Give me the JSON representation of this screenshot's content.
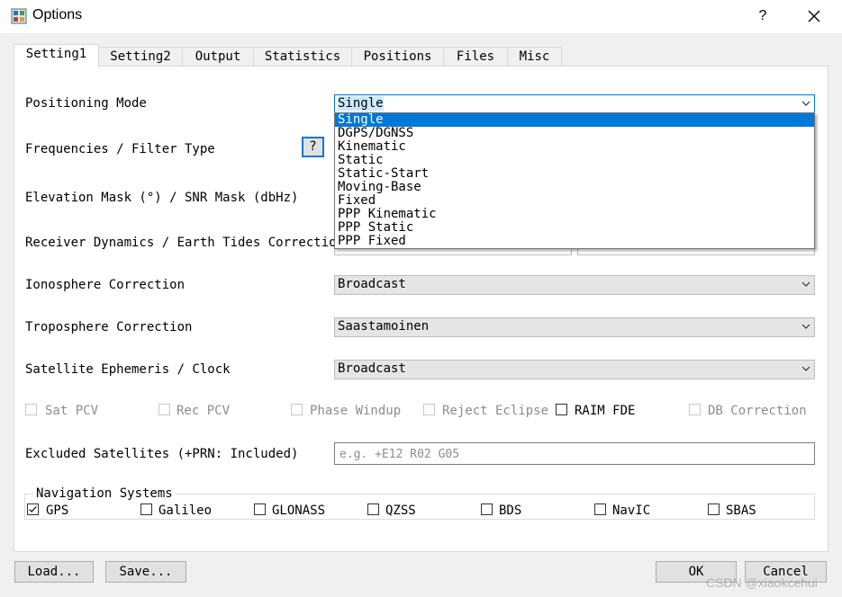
{
  "window": {
    "title": "Options",
    "help": "?"
  },
  "tabs": [
    "Setting1",
    "Setting2",
    "Output",
    "Statistics",
    "Positions",
    "Files",
    "Misc"
  ],
  "labels": {
    "positioning_mode": "Positioning Mode",
    "frequencies": "Frequencies / Filter Type",
    "elevation": "Elevation Mask (°) / SNR Mask (dbHz)",
    "receiver": "Receiver Dynamics / Earth Tides Correction",
    "ionosphere": "Ionosphere Correction",
    "troposphere": "Troposphere Correction",
    "ephemeris": "Satellite Ephemeris / Clock",
    "excluded": "Excluded Satellites (+PRN: Included)"
  },
  "combos": {
    "positioning_mode": "Single",
    "ionosphere": "Broadcast",
    "troposphere": "Saastamoinen",
    "ephemeris": "Broadcast"
  },
  "help_button": "?",
  "dropdown_options": [
    "Single",
    "DGPS/DGNSS",
    "Kinematic",
    "Static",
    "Static-Start",
    "Moving-Base",
    "Fixed",
    "PPP Kinematic",
    "PPP Static",
    "PPP Fixed"
  ],
  "options_row": [
    {
      "label": "Sat PCV",
      "checked": false,
      "enabled": false
    },
    {
      "label": "Rec PCV",
      "checked": false,
      "enabled": false
    },
    {
      "label": "Phase Windup",
      "checked": false,
      "enabled": false
    },
    {
      "label": "Reject Eclipse",
      "checked": false,
      "enabled": false
    },
    {
      "label": "RAIM FDE",
      "checked": false,
      "enabled": true
    },
    {
      "label": "DB Correction",
      "checked": false,
      "enabled": false
    }
  ],
  "excluded_placeholder": "e.g. +E12 R02 G05",
  "nav_title": "Navigation Systems",
  "nav_systems": [
    {
      "label": "GPS",
      "checked": true
    },
    {
      "label": "Galileo",
      "checked": false
    },
    {
      "label": "GLONASS",
      "checked": false
    },
    {
      "label": "QZSS",
      "checked": false
    },
    {
      "label": "BDS",
      "checked": false
    },
    {
      "label": "NavIC",
      "checked": false
    },
    {
      "label": "SBAS",
      "checked": false
    }
  ],
  "buttons": {
    "load": "Load...",
    "save": "Save...",
    "ok": "OK",
    "cancel": "Cancel"
  },
  "watermark": "CSDN @xiaokcehui",
  "colors": {
    "accent": "#0078d7",
    "selection": "#cce8ff"
  }
}
